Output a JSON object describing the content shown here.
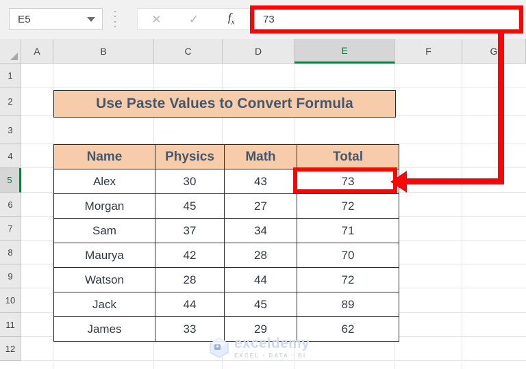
{
  "formula_bar": {
    "name_box_value": "E5",
    "name_box_icon": "chevron-down-icon",
    "grip_icon": "vertical-dots-icon",
    "cancel_icon": "✕",
    "confirm_icon": "✓",
    "fx_icon": "f",
    "fx_icon_sub": "x",
    "formula_value": "73",
    "highlight_color": "#fb0606"
  },
  "grid": {
    "column_headers": [
      "A",
      "B",
      "C",
      "D",
      "E",
      "F",
      "G"
    ],
    "selected_column": "E",
    "row_headers": [
      "1",
      "2",
      "3",
      "4",
      "5",
      "6",
      "7",
      "8",
      "9",
      "10",
      "11",
      "12"
    ],
    "selected_row": "5",
    "selection_color": "#127d42"
  },
  "sheet": {
    "title_banner": "Use Paste Values to Convert Formula",
    "banner_fill": "#f7ccab",
    "banner_text_color": "#47576b",
    "table": {
      "headers": [
        "Name",
        "Physics",
        "Math",
        "Total"
      ],
      "rows": [
        {
          "name": "Alex",
          "physics": "30",
          "math": "43",
          "total": "73"
        },
        {
          "name": "Morgan",
          "physics": "45",
          "math": "27",
          "total": "72"
        },
        {
          "name": "Sam",
          "physics": "37",
          "math": "34",
          "total": "71"
        },
        {
          "name": "Maurya",
          "physics": "42",
          "math": "28",
          "total": "70"
        },
        {
          "name": "Watson",
          "physics": "28",
          "math": "44",
          "total": "72"
        },
        {
          "name": "Jack",
          "physics": "44",
          "math": "45",
          "total": "89"
        },
        {
          "name": "James",
          "physics": "33",
          "math": "29",
          "total": "62"
        }
      ]
    }
  },
  "annotation": {
    "arrow_color": "#fb0606",
    "arrow_icon": "left-arrow-icon",
    "target_cell": "E5"
  },
  "watermark": {
    "logo_icon": "cube-logo-icon",
    "title": "exceldemy",
    "subtitle": "EXCEL · DATA · BI"
  }
}
